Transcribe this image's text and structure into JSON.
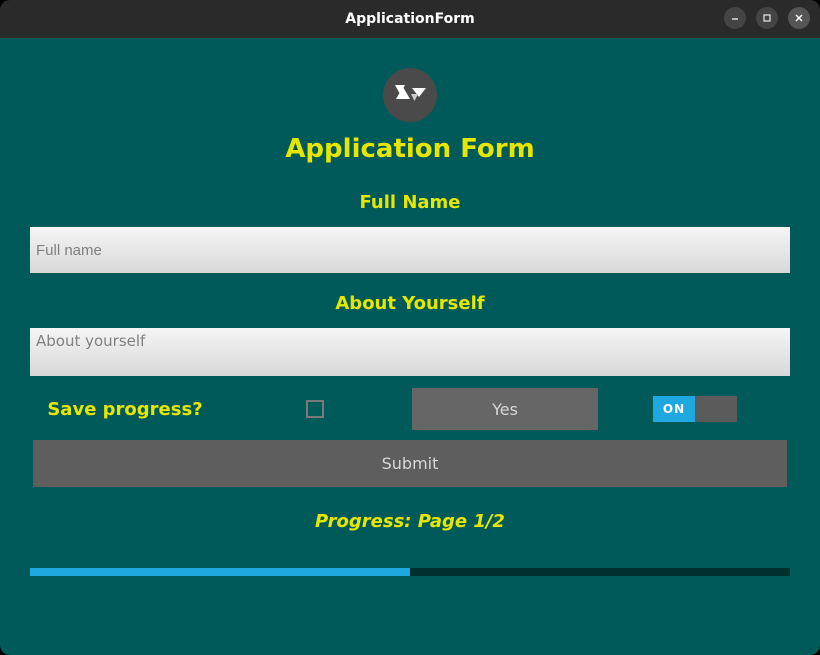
{
  "window": {
    "title": "ApplicationForm"
  },
  "header": {
    "title": "Application Form"
  },
  "fields": {
    "fullname": {
      "label": "Full Name",
      "placeholder": "Full name",
      "value": ""
    },
    "about": {
      "label": "About Yourself",
      "placeholder": "About yourself",
      "value": ""
    }
  },
  "controls": {
    "save_progress_label": "Save progress?",
    "checkbox_checked": false,
    "yes_button_label": "Yes",
    "switch_state": "ON",
    "submit_label": "Submit"
  },
  "progress": {
    "label": "Progress: Page 1/2",
    "current": 1,
    "total": 2,
    "percent": 50
  },
  "colors": {
    "background": "#005a5a",
    "accent_text": "#e6e600",
    "switch_on": "#1fa8e0",
    "progress_fill": "#1fa8e0"
  }
}
